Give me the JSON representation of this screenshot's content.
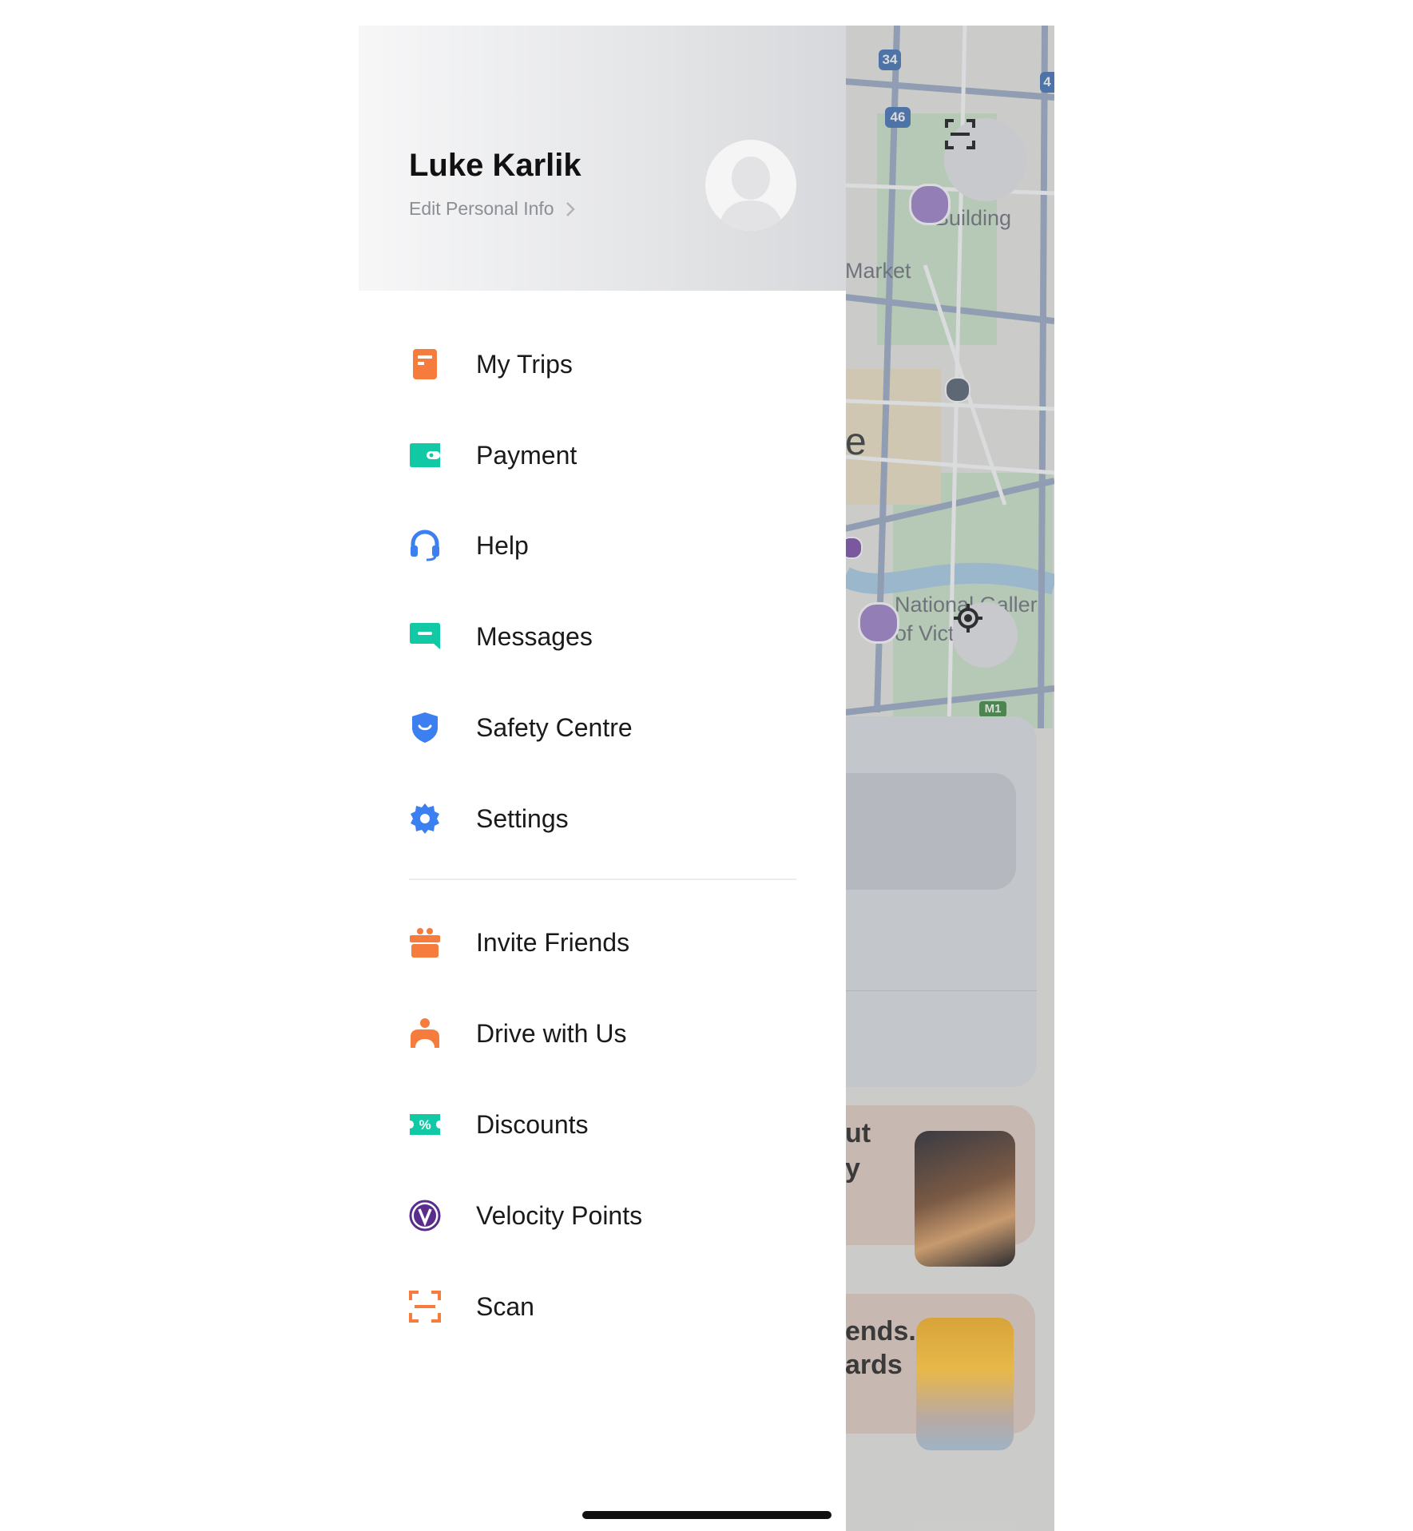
{
  "drawer": {
    "user_name": "Luke Karlik",
    "edit_info": "Edit Personal Info",
    "menu_primary": [
      {
        "label": "My Trips",
        "icon": "trips-icon",
        "color": "#f57c3d"
      },
      {
        "label": "Payment",
        "icon": "wallet-icon",
        "color": "#12c9a6"
      },
      {
        "label": "Help",
        "icon": "headset-icon",
        "color": "#3b7ff0"
      },
      {
        "label": "Messages",
        "icon": "message-icon",
        "color": "#12c9a6"
      },
      {
        "label": "Safety Centre",
        "icon": "shield-icon",
        "color": "#3b7ff0"
      },
      {
        "label": "Settings",
        "icon": "gear-icon",
        "color": "#3b7ff0"
      }
    ],
    "menu_secondary": [
      {
        "label": "Invite Friends",
        "icon": "gift-icon",
        "color": "#f57c3d"
      },
      {
        "label": "Drive with Us",
        "icon": "driver-icon",
        "color": "#f57c3d"
      },
      {
        "label": "Discounts",
        "icon": "discount-ticket-icon",
        "color": "#12c9a6"
      },
      {
        "label": "Velocity Points",
        "icon": "velocity-v-icon",
        "color": "#5a2d8c"
      },
      {
        "label": "Scan",
        "icon": "scan-icon",
        "color": "#f57c3d"
      }
    ]
  },
  "map": {
    "route_badges": [
      "34",
      "46",
      "4",
      "M1"
    ],
    "labels": [
      "Building",
      "Market",
      "National Galler",
      "of Vict",
      "e"
    ],
    "card1_text": [
      "ut",
      "y"
    ],
    "card2_text": [
      "ends.",
      "ards"
    ]
  }
}
